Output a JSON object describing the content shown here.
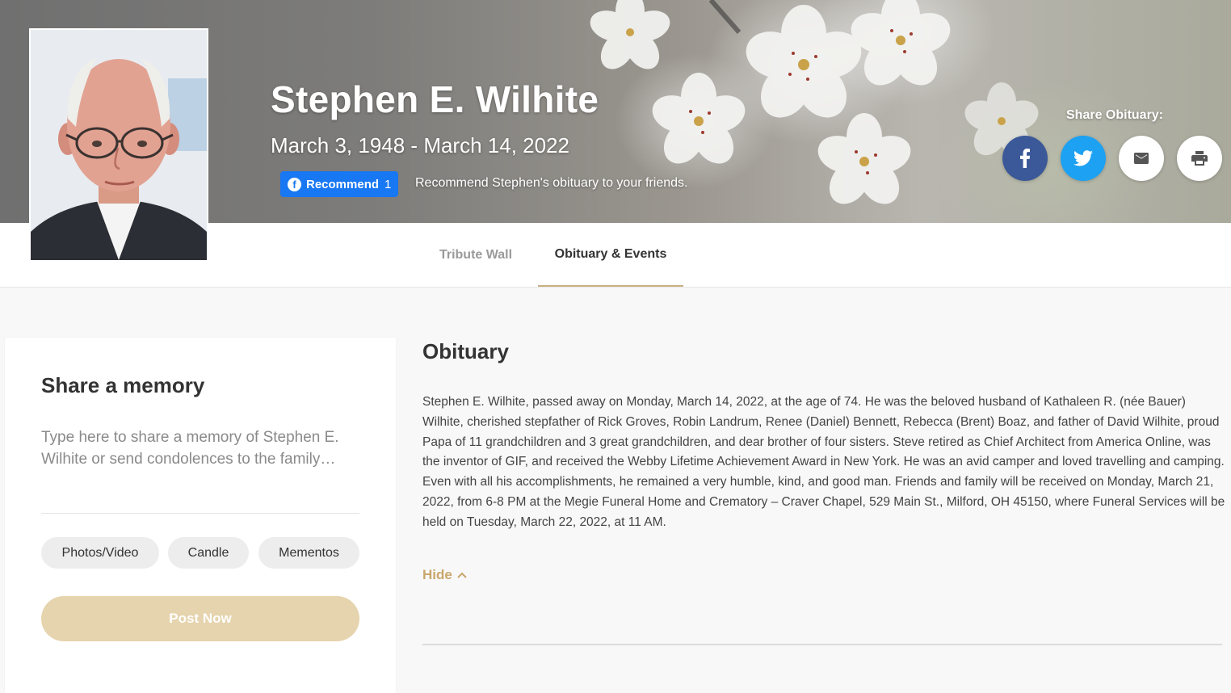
{
  "hero": {
    "name": "Stephen E. Wilhite",
    "dates": "March 3, 1948 - March 14, 2022",
    "recommend_label": "Recommend",
    "recommend_count": "1",
    "recommend_text": "Recommend Stephen's obituary to your friends.",
    "share_label": "Share Obituary:",
    "share_icons": [
      "facebook-icon",
      "twitter-icon",
      "email-icon",
      "print-icon"
    ]
  },
  "tabs": [
    {
      "label": "Tribute Wall",
      "active": false
    },
    {
      "label": "Obituary & Events",
      "active": true
    }
  ],
  "memory": {
    "title": "Share a memory",
    "placeholder": "Type here to share a memory of Stephen E. Wilhite or send condolences to the family…",
    "options": [
      "Photos/Video",
      "Candle",
      "Mementos"
    ],
    "post_label": "Post Now"
  },
  "obituary": {
    "title": "Obituary",
    "text": "Stephen E. Wilhite, passed away on Monday, March 14, 2022, at the age of 74. He was the beloved husband of Kathaleen R. (née Bauer) Wilhite, cherished stepfather of Rick Groves, Robin Landrum, Renee (Daniel) Bennett, Rebecca (Brent) Boaz, and father of David Wilhite, proud Papa of 11 grandchildren and 3 great grandchildren, and dear brother of four sisters. Steve retired as Chief Architect from America Online, was the inventor of GIF, and received the Webby Lifetime Achievement Award in New York. He was an avid camper and loved travelling and camping. Even with all his accomplishments, he remained a very humble, kind, and good man. Friends and family will be received on Monday, March 21, 2022, from 6-8 PM at the Megie Funeral Home and Crematory – Craver Chapel, 529 Main St., Milford, OH 45150, where Funeral Services will be held on Tuesday, March 22, 2022, at 11 AM.",
    "hide_label": "Hide"
  },
  "colors": {
    "accent": "#c9a66b",
    "post_button": "#e6d4ae",
    "facebook": "#3b5998",
    "twitter": "#1da1f2",
    "fb_recommend": "#1877f2"
  }
}
